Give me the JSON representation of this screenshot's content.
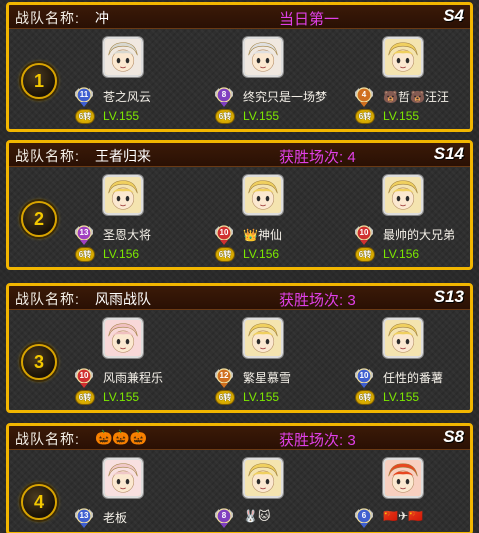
{
  "header_label": "战队名称:",
  "teams": [
    {
      "rank": "1",
      "name": "冲",
      "stat": "当日第一",
      "server": "S4",
      "members": [
        {
          "name": "苍之风云",
          "badge_level": "11",
          "badge_color": "#4060d0",
          "rebirth": "6转",
          "lv": "LV.155",
          "avatar_color": "#f0e8e0",
          "hair_color": "#d8d8d0"
        },
        {
          "name": "终究只是一场梦",
          "badge_level": "8",
          "badge_color": "#8040c0",
          "rebirth": "6转",
          "lv": "LV.155",
          "avatar_color": "#f0e8e0",
          "hair_color": "#e0e0e0"
        },
        {
          "name": "🐻哲🐻汪汪",
          "badge_level": "4",
          "badge_color": "#d07020",
          "rebirth": "6转",
          "lv": "LV.155",
          "avatar_color": "#f4e4b0",
          "hair_color": "#f0d060"
        }
      ]
    },
    {
      "rank": "2",
      "name": "王者归来",
      "stat": "获胜场次: 4",
      "server": "S14",
      "members": [
        {
          "name": "圣恩大将",
          "badge_level": "13",
          "badge_color": "#a040c0",
          "rebirth": "6转",
          "lv": "LV.156",
          "avatar_color": "#f4e4b0",
          "hair_color": "#f0d060"
        },
        {
          "name": "👑神仙",
          "badge_level": "10",
          "badge_color": "#d03030",
          "rebirth": "6转",
          "lv": "LV.156",
          "avatar_color": "#f4e4b0",
          "hair_color": "#f0d060"
        },
        {
          "name": "最帅的大兄弟",
          "badge_level": "10",
          "badge_color": "#d03030",
          "rebirth": "6转",
          "lv": "LV.156",
          "avatar_color": "#f4e4b0",
          "hair_color": "#f0d060"
        }
      ]
    },
    {
      "rank": "3",
      "name": "风雨战队",
      "stat": "获胜场次: 3",
      "server": "S13",
      "members": [
        {
          "name": "风雨兼程乐",
          "badge_level": "10",
          "badge_color": "#d03030",
          "rebirth": "6转",
          "lv": "LV.155",
          "avatar_color": "#f8d8d8",
          "hair_color": "#f0c0c0"
        },
        {
          "name": "繁星慕雪",
          "badge_level": "12",
          "badge_color": "#d07020",
          "rebirth": "6转",
          "lv": "LV.155",
          "avatar_color": "#f4e4b0",
          "hair_color": "#f0d060"
        },
        {
          "name": "任性的番薯",
          "badge_level": "10",
          "badge_color": "#4060d0",
          "rebirth": "6转",
          "lv": "LV.155",
          "avatar_color": "#f4e4b0",
          "hair_color": "#f0d060"
        }
      ]
    },
    {
      "rank": "4",
      "name": "🎃🎃🎃",
      "stat": "获胜场次: 3",
      "server": "S8",
      "members": [
        {
          "name": "老板",
          "badge_level": "13",
          "badge_color": "#4060d0",
          "rebirth": "",
          "lv": "",
          "avatar_color": "#f8e0e0",
          "hair_color": "#f0c8c8"
        },
        {
          "name": "🐰🐱",
          "badge_level": "8",
          "badge_color": "#8040c0",
          "rebirth": "",
          "lv": "",
          "avatar_color": "#f4e4b0",
          "hair_color": "#f0d060"
        },
        {
          "name": "🇨🇳✈🇨🇳",
          "badge_level": "6",
          "badge_color": "#4060d0",
          "rebirth": "",
          "lv": "",
          "avatar_color": "#f8d0c0",
          "hair_color": "#e84820"
        }
      ]
    }
  ]
}
